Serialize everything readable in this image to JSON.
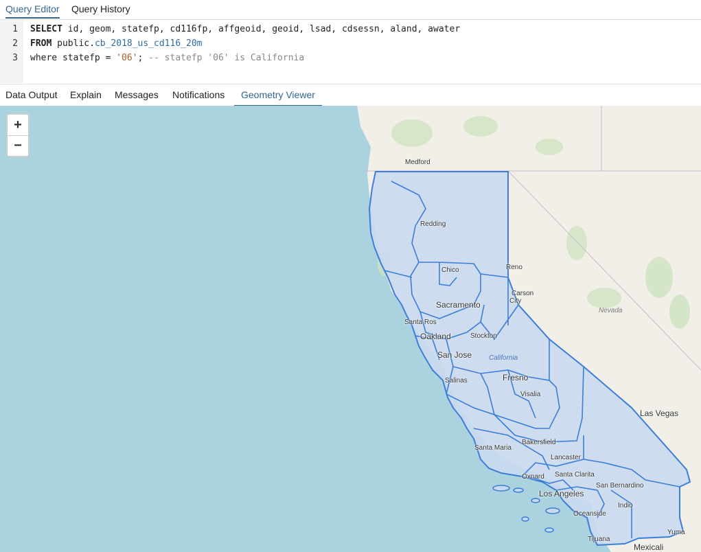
{
  "top_tabs": [
    {
      "label": "Query Editor",
      "active": true
    },
    {
      "label": "Query History",
      "active": false
    }
  ],
  "editor": {
    "line_numbers": [
      "1",
      "2",
      "3"
    ],
    "line1": {
      "kw": "SELECT",
      "rest": " id, geom, statefp, cd116fp, affgeoid, geoid, lsad, cdsessn, aland, awater"
    },
    "line2": {
      "kw": "FROM",
      "schema": " public.",
      "table": "cb_2018_us_cd116_20m"
    },
    "line3": {
      "pre": "where statefp = ",
      "value": "'06'",
      "sep": "; ",
      "comment": "-- statefp '06' is California"
    }
  },
  "result_tabs": [
    {
      "label": "Data Output"
    },
    {
      "label": "Explain"
    },
    {
      "label": "Messages"
    },
    {
      "label": "Notifications"
    },
    {
      "label": "Geometry Viewer",
      "active": true
    }
  ],
  "map": {
    "zoom_in": "+",
    "zoom_out": "−",
    "colors": {
      "ocean": "#aad3df",
      "land": "#f2efe9",
      "boundary": "#3b7dd8",
      "fill": "#c9d9f0"
    },
    "cities": {
      "medford": "Medford",
      "redding": "Redding",
      "chico": "Chico",
      "reno": "Reno",
      "carson_city_1": "Carson",
      "carson_city_2": "City",
      "sacramento": "Sacramento",
      "santa_rosa": "Santa Ros",
      "oakland": "Oakland",
      "stockton": "Stockton",
      "san_jose": "San Jose",
      "salinas": "Salinas",
      "fresno": "Fresno",
      "visalia": "Visalia",
      "las_vegas": "Las Vegas",
      "bakersfield": "Bakersfield",
      "santa_maria": "Santa Maria",
      "lancaster": "Lancaster",
      "santa_clarita": "Santa Clarita",
      "oxnard": "Oxnard",
      "san_bernardino": "San Bernardino",
      "los_angeles": "Los Angeles",
      "indio": "Indio",
      "oceanside": "Oceanside",
      "yuma": "Yuma",
      "tijuana": "Tijuana",
      "mexicali": "Mexicali"
    },
    "regions": {
      "nevada": "Nevada",
      "california": "California"
    }
  }
}
